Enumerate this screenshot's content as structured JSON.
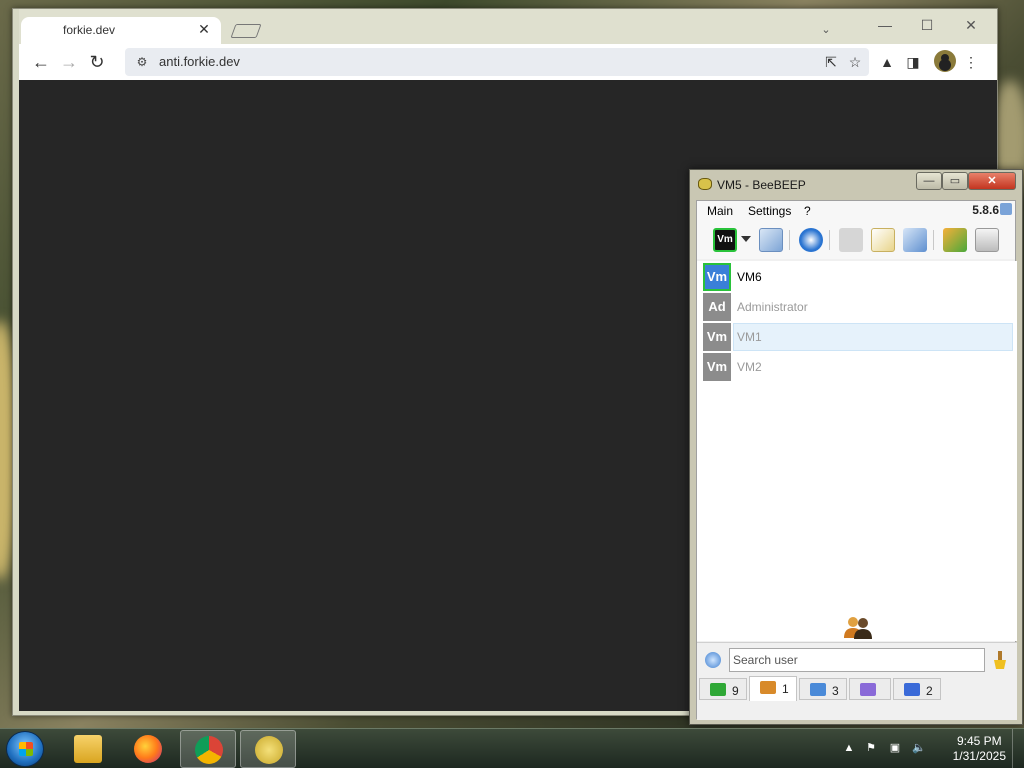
{
  "browser": {
    "tab_title": "forkie.dev",
    "tab_close": "✕",
    "url": "anti.forkie.dev",
    "icons": {
      "back": "arrow-left-icon",
      "forward": "arrow-right-icon",
      "reload": "reload-icon",
      "site_settings": "tune-icon",
      "share": "share-icon",
      "bookmark": "star-icon",
      "labs": "flask-icon",
      "side_panel": "side-panel-icon",
      "profile": "profile-avatar-icon",
      "menu": "kebab-menu-icon"
    },
    "window_controls": {
      "minimize": "—",
      "maximize": "☐",
      "close": "✕"
    }
  },
  "beebeep": {
    "title": "VM5 - BeeBEEP",
    "menu": [
      "Main",
      "Settings",
      "?"
    ],
    "version": "5.8.6",
    "current_user_badge": "Vm",
    "users": [
      {
        "badge": "Vm",
        "name": "VM6",
        "online": true
      },
      {
        "badge": "Ad",
        "name": "Administrator",
        "online": false
      },
      {
        "badge": "Vm",
        "name": "VM1",
        "online": false,
        "selected": true
      },
      {
        "badge": "Vm",
        "name": "VM2",
        "online": false
      }
    ],
    "search_placeholder": "Search user",
    "tabs": [
      {
        "icon": "users-online-icon",
        "count": "9",
        "color": "#2fa836"
      },
      {
        "icon": "users-icon",
        "count": "1",
        "color": "#d88a2a",
        "selected": true
      },
      {
        "icon": "chats-icon",
        "count": "3",
        "color": "#4a8ad8"
      },
      {
        "icon": "groups-icon",
        "count": "",
        "color": "#8a6ad8"
      },
      {
        "icon": "files-icon",
        "count": "2",
        "color": "#3a6ad8"
      }
    ],
    "window_controls": {
      "minimize": "—",
      "maximize": "▭",
      "close": "✕"
    }
  },
  "taskbar": {
    "apps": [
      "explorer-icon",
      "firefox-icon",
      "chrome-icon",
      "beebeep-icon"
    ],
    "tray": [
      "show-hidden-icons-icon",
      "action-center-flag-icon",
      "network-icon",
      "volume-muted-icon"
    ],
    "time": "9:45 PM",
    "date": "1/31/2025"
  }
}
